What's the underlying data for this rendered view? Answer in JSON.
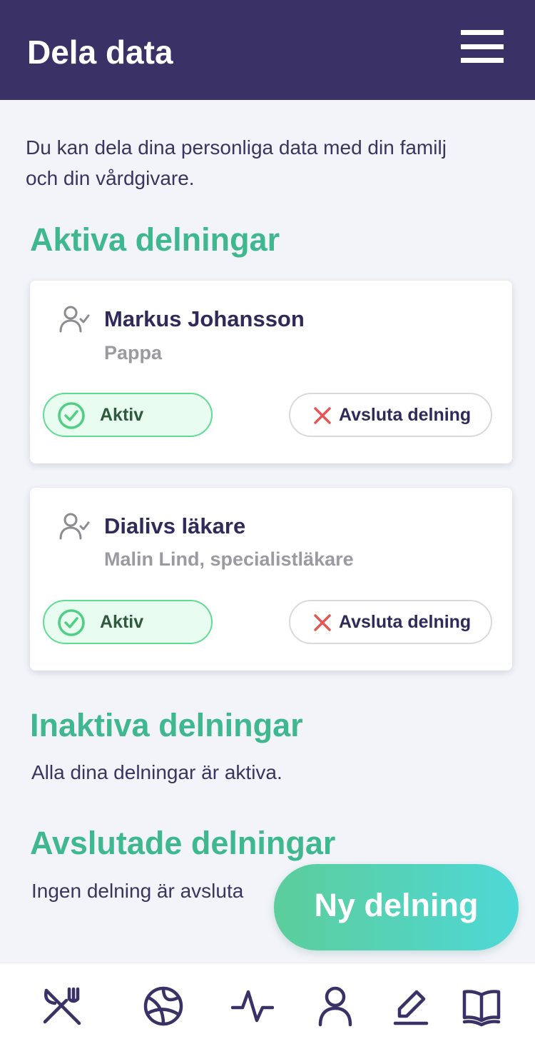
{
  "header": {
    "title": "Dela data"
  },
  "intro": "Du kan dela dina personliga data med din familj och din vårdgivare.",
  "sections": {
    "active_title": "Aktiva delningar",
    "inactive_title": "Inaktiva delningar",
    "inactive_text": "Alla dina delningar är aktiva.",
    "ended_title": "Avslutade delningar",
    "ended_text": "Ingen delning är avsluta"
  },
  "shares": [
    {
      "name": "Markus Johansson",
      "subtitle": "Pappa",
      "status": "Aktiv",
      "end_label": "Avsluta delning"
    },
    {
      "name": "Dialivs läkare",
      "subtitle": "Malin Lind, specialistläkare",
      "status": "Aktiv",
      "end_label": "Avsluta delning"
    }
  ],
  "fab_label": "Ny delning",
  "tabbar": [
    "food-icon",
    "ball-icon",
    "activity-icon",
    "profile-icon",
    "edit-icon",
    "book-icon"
  ],
  "colors": {
    "header": "#3a3166",
    "accent": "#3fb88f",
    "active_border": "#5fdc92",
    "close_red": "#e85555"
  }
}
